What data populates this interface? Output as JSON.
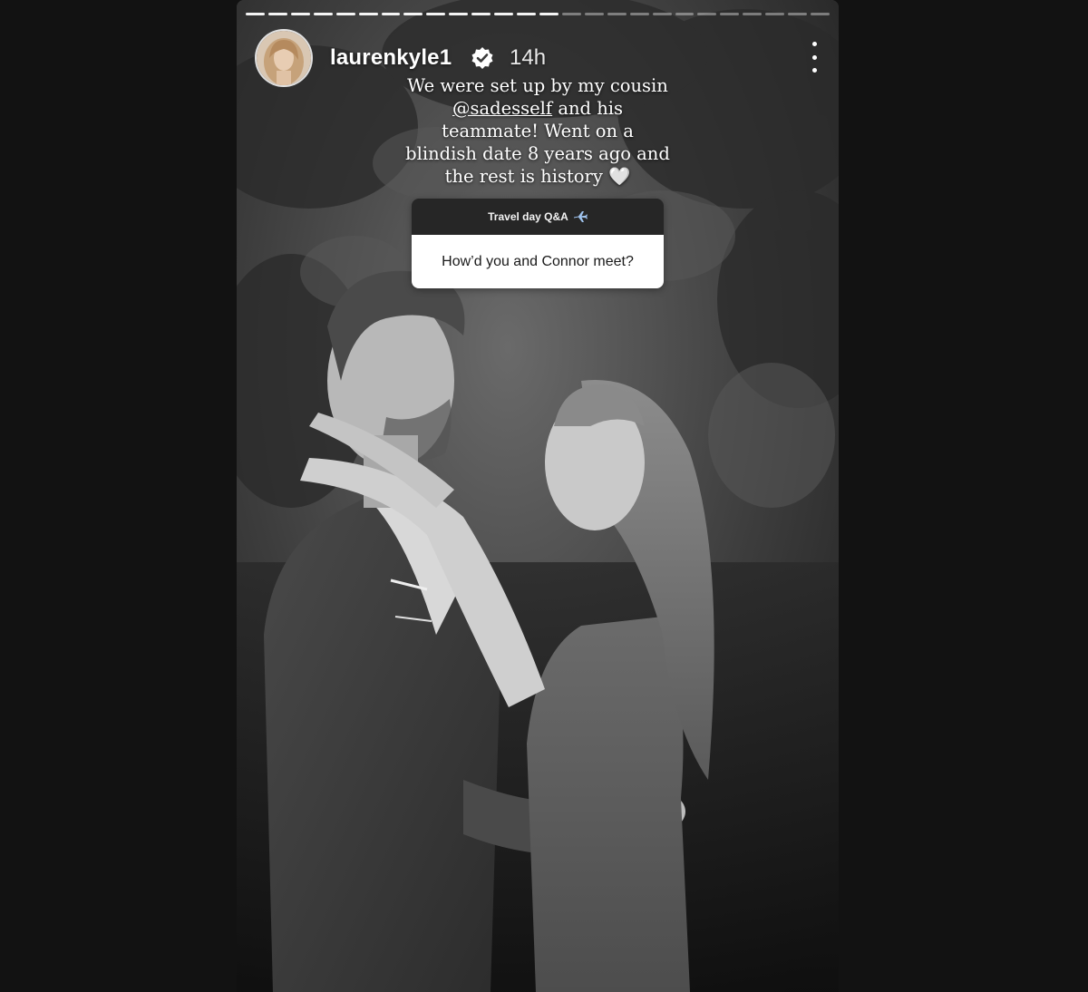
{
  "story": {
    "progress": {
      "segments_total": 26,
      "segments_viewed": 14
    },
    "user": {
      "username": "laurenkyle1",
      "verified_icon": "verified-badge-icon",
      "time": "14h"
    },
    "caption": {
      "line1": "We were set up by my cousin",
      "mention": "@sadesself",
      "line2_rest": " and his",
      "line3": "teammate! Went on a",
      "line4": "blindish date 8 years ago and",
      "line5": "the rest is history",
      "emoji": "🤍"
    },
    "question_sticker": {
      "title": "Travel day Q&A",
      "icon": "airplane-icon",
      "question": "How’d you and Connor meet?"
    },
    "photo": {
      "description_icon": "couple-photo",
      "style": "black-and-white"
    }
  },
  "colors": {
    "page_background": "#121212",
    "sticker_header": "#262626",
    "sticker_body": "#ffffff",
    "verified_badge": "#ffffff"
  }
}
